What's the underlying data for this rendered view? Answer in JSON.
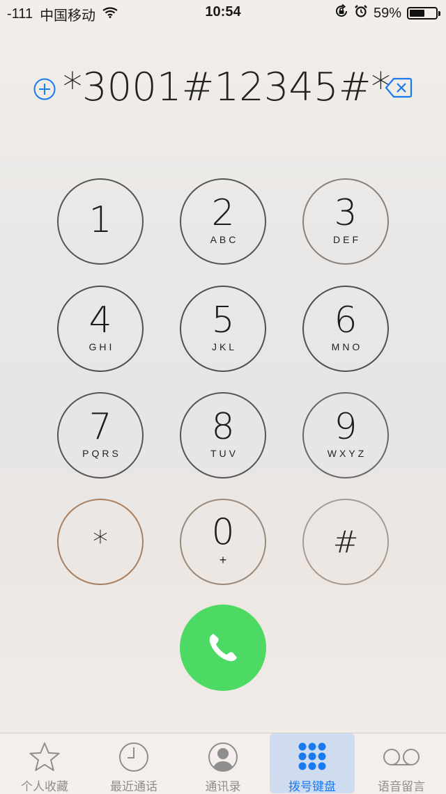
{
  "status_bar": {
    "signal": "-111",
    "carrier": "中国移动",
    "time": "10:54",
    "battery_percent": "59%",
    "battery_level": 0.59
  },
  "dialer": {
    "number": "*3001#12345#*",
    "keys": [
      {
        "digit": "1",
        "letters": ""
      },
      {
        "digit": "2",
        "letters": "ABC"
      },
      {
        "digit": "3",
        "letters": "DEF"
      },
      {
        "digit": "4",
        "letters": "GHI"
      },
      {
        "digit": "5",
        "letters": "JKL"
      },
      {
        "digit": "6",
        "letters": "MNO"
      },
      {
        "digit": "7",
        "letters": "PQRS"
      },
      {
        "digit": "8",
        "letters": "TUV"
      },
      {
        "digit": "9",
        "letters": "WXYZ"
      },
      {
        "digit": "*",
        "letters": ""
      },
      {
        "digit": "0",
        "letters": "+"
      },
      {
        "digit": "#",
        "letters": ""
      }
    ],
    "call_color": "#4cd964",
    "accent_color": "#1a7af0"
  },
  "tab_bar": {
    "tabs": [
      {
        "label": "个人收藏",
        "icon": "star-icon"
      },
      {
        "label": "最近通话",
        "icon": "clock-icon"
      },
      {
        "label": "通讯录",
        "icon": "contacts-icon"
      },
      {
        "label": "拨号键盘",
        "icon": "keypad-icon",
        "active": true
      },
      {
        "label": "语音留言",
        "icon": "voicemail-icon"
      }
    ]
  }
}
